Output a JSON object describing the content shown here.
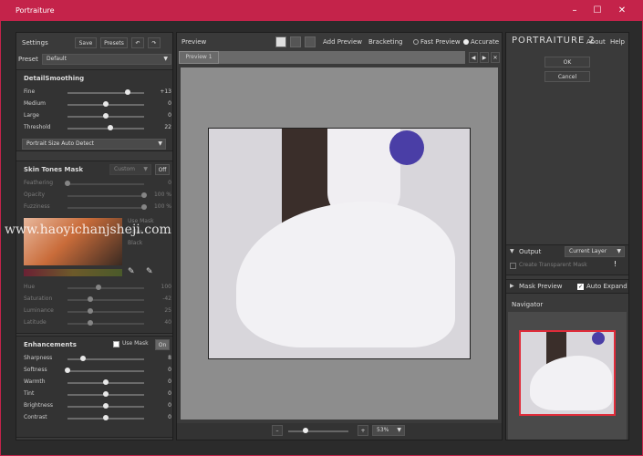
{
  "window": {
    "title": "Portraiture",
    "min": "–",
    "max": "☐",
    "close": "✕"
  },
  "left": {
    "settings_label": "Settings",
    "save_label": "Save",
    "presets_label": "Presets",
    "preset_label": "Preset",
    "preset_value": "Default",
    "detail": {
      "title": "DetailSmoothing",
      "sliders": [
        {
          "label": "Fine",
          "value": "+13",
          "pos": 0.78
        },
        {
          "label": "Medium",
          "value": "0",
          "pos": 0.5
        },
        {
          "label": "Large",
          "value": "0",
          "pos": 0.5
        },
        {
          "label": "Threshold",
          "value": "22",
          "pos": 0.56
        }
      ],
      "portrait_size": "Portrait Size Auto Detect"
    },
    "skin": {
      "title": "Skin Tones Mask",
      "mode": "Custom",
      "toggle": "Off",
      "sliders": [
        {
          "label": "Feathering",
          "value": "0",
          "pos": 0.0
        },
        {
          "label": "Opacity",
          "value": "100 %",
          "pos": 1.0
        },
        {
          "label": "Fuzziness",
          "value": "100 %",
          "pos": 1.0
        }
      ],
      "options": [
        "Use Mask",
        "Color",
        "Black"
      ],
      "sliders2": [
        {
          "label": "Hue",
          "value": "100",
          "pos": 0.4
        },
        {
          "label": "Saturation",
          "value": "-42",
          "pos": 0.3
        },
        {
          "label": "Luminance",
          "value": "25",
          "pos": 0.3
        },
        {
          "label": "Latitude",
          "value": "40",
          "pos": 0.3
        }
      ]
    },
    "enh": {
      "title": "Enhancements",
      "use_mask": "Use Mask",
      "toggle": "On",
      "sliders": [
        {
          "label": "Sharpness",
          "value": "8",
          "pos": 0.2
        },
        {
          "label": "Softness",
          "value": "0",
          "pos": 0.0
        },
        {
          "label": "Warmth",
          "value": "0",
          "pos": 0.5
        },
        {
          "label": "Tint",
          "value": "0",
          "pos": 0.5
        },
        {
          "label": "Brightness",
          "value": "0",
          "pos": 0.5
        },
        {
          "label": "Contrast",
          "value": "0",
          "pos": 0.5
        }
      ]
    }
  },
  "center": {
    "preview_label": "Preview",
    "add_preview": "Add Preview",
    "bracketing": "Bracketing",
    "fast_preview": "Fast Preview",
    "accurate": "Accurate",
    "tab": "Preview 1",
    "zoom": "53%",
    "minus": "–",
    "plus": "+"
  },
  "right": {
    "logo": "PORTRAITURE 2",
    "about": "About",
    "help": "Help",
    "ok": "OK",
    "cancel": "Cancel",
    "output_label": "Output",
    "output_value": "Current Layer",
    "create_transparent": "Create Transparent Mask",
    "warning": "!",
    "mask_preview": "Mask Preview",
    "auto_expand": "Auto Expand",
    "navigator": "Navigator"
  },
  "watermark": "www.haoyichanjsheji.com",
  "colors": {
    "accent": "#c4234a",
    "panel": "#3a3a3a",
    "canvas": "#8d8d8d"
  }
}
